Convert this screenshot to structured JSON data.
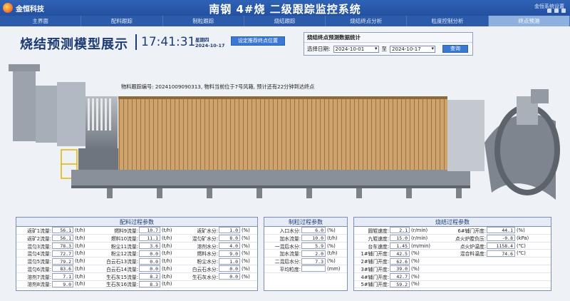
{
  "brand": {
    "name": "金恒科技"
  },
  "header": {
    "title": "南钢 4#烧 二级跟踪监控系统",
    "toplink": "金恒系统设置"
  },
  "nav": {
    "tabs": [
      {
        "label": "主界面",
        "active": false
      },
      {
        "label": "配料跟踪",
        "active": false
      },
      {
        "label": "制粒跟踪",
        "active": false
      },
      {
        "label": "烧结跟踪",
        "active": false
      },
      {
        "label": "烧结终点分析",
        "active": false
      },
      {
        "label": "粒度控制分析",
        "active": false
      },
      {
        "label": "终点预测",
        "active": true
      }
    ]
  },
  "page": {
    "title": "烧结预测模型展示",
    "clock": "17:41:31",
    "weekday": "星期四",
    "date": "2024-10-17",
    "set_button": "设定推荐终点位置"
  },
  "stats": {
    "title": "烧结终点预测数据统计",
    "date_label": "选择日期:",
    "start": "2024-10-01",
    "tilde": "至",
    "end": "2024-10-17",
    "query": "查询"
  },
  "tracking": {
    "text": "物料跟踪编号: 20241009090313, 物料当前位于7号风箱, 预计还有22分钟到达终点"
  },
  "colors": {
    "nav": "#2c5bab",
    "active_tab": "#8eb0df",
    "accent": "#3a78d4",
    "panel_border": "#7a8fb8"
  },
  "batching": {
    "title": "配料过程参数",
    "rows": [
      [
        {
          "label": "返矿1流量:",
          "value": "56.1",
          "unit": "(t/h)"
        },
        {
          "label": "燃料9流量:",
          "value": "10.7",
          "unit": "(t/h)"
        },
        {
          "label": "返矿水分:",
          "value": "1.0",
          "unit": "(%)"
        }
      ],
      [
        {
          "label": "返矿2流量:",
          "value": "56.1",
          "unit": "(t/h)"
        },
        {
          "label": "燃料10流量:",
          "value": "11.1",
          "unit": "(t/h)"
        },
        {
          "label": "混匀矿水分:",
          "value": "8.0",
          "unit": "(%)"
        }
      ],
      [
        {
          "label": "混匀3流量:",
          "value": "78.3",
          "unit": "(t/h)"
        },
        {
          "label": "粉尘11流量:",
          "value": "3.6",
          "unit": "(t/h)"
        },
        {
          "label": "溶剂水分:",
          "value": "4.0",
          "unit": "(%)"
        }
      ],
      [
        {
          "label": "混匀4流量:",
          "value": "72.7",
          "unit": "(t/h)"
        },
        {
          "label": "粉尘12流量:",
          "value": "0.0",
          "unit": "(t/h)"
        },
        {
          "label": "燃料水分:",
          "value": "9.0",
          "unit": "(%)"
        }
      ],
      [
        {
          "label": "混匀5流量:",
          "value": "79.2",
          "unit": "(t/h)"
        },
        {
          "label": "白云石13流量:",
          "value": "0.0",
          "unit": "(t/h)"
        },
        {
          "label": "粉尘水分:",
          "value": "1.0",
          "unit": "(%)"
        }
      ],
      [
        {
          "label": "混匀6流量:",
          "value": "83.6",
          "unit": "(t/h)"
        },
        {
          "label": "白云石14流量:",
          "value": "0.0",
          "unit": "(t/h)"
        },
        {
          "label": "白云石水分:",
          "value": "0.0",
          "unit": "(%)"
        }
      ],
      [
        {
          "label": "溶剂7流量:",
          "value": "7.1",
          "unit": "(t/h)"
        },
        {
          "label": "生石灰15流量:",
          "value": "8.2",
          "unit": "(t/h)"
        },
        {
          "label": "生石灰水分:",
          "value": "0.0",
          "unit": "(%)"
        }
      ],
      [
        {
          "label": "溶剂8流量:",
          "value": "9.0",
          "unit": "(t/h)"
        },
        {
          "label": "生石灰16流量:",
          "value": "8.3",
          "unit": "(t/h)"
        }
      ]
    ]
  },
  "granulation": {
    "title": "制粒过程参数",
    "rows": [
      [
        {
          "label": "入口水分:",
          "value": "6.0",
          "unit": "(%)"
        }
      ],
      [
        {
          "label": "加水流量:",
          "value": "10.0",
          "unit": "(t/h)"
        }
      ],
      [
        {
          "label": "一混后水分:",
          "value": "5.9",
          "unit": "(%)"
        }
      ],
      [
        {
          "label": "加水流量:",
          "value": "2.0",
          "unit": "(t/h)"
        }
      ],
      [
        {
          "label": "二混后水分:",
          "value": "7.3",
          "unit": "(%)"
        }
      ],
      [
        {
          "label": "平均粒度:",
          "value": "",
          "unit": "(mm)"
        }
      ]
    ]
  },
  "sintering": {
    "title": "烧结过程参数",
    "rows": [
      [
        {
          "label": "圆辊速度:",
          "value": "2.1",
          "unit": "(r/min)"
        },
        {
          "label": "6#辅门开度:",
          "value": "44.1",
          "unit": "(%)"
        }
      ],
      [
        {
          "label": "九辊速度:",
          "value": "15.0",
          "unit": "(r/min)"
        },
        {
          "label": "点火炉膛负压:",
          "value": "-0.8",
          "unit": "(kPa)"
        }
      ],
      [
        {
          "label": "台车速度:",
          "value": "1.45",
          "unit": "(m/min)"
        },
        {
          "label": "点火炉温度:",
          "value": "1158.4",
          "unit": "(℃)"
        }
      ],
      [
        {
          "label": "1#辅门开度:",
          "value": "42.5",
          "unit": "(%)"
        },
        {
          "label": "混合料温度:",
          "value": "74.6",
          "unit": "(℃)"
        }
      ],
      [
        {
          "label": "2#辅门开度:",
          "value": "62.6",
          "unit": "(%)"
        }
      ],
      [
        {
          "label": "3#辅门开度:",
          "value": "39.0",
          "unit": "(%)"
        }
      ],
      [
        {
          "label": "4#辅门开度:",
          "value": "42.7",
          "unit": "(%)"
        }
      ],
      [
        {
          "label": "5#辅门开度:",
          "value": "59.2",
          "unit": "(%)"
        }
      ]
    ]
  }
}
